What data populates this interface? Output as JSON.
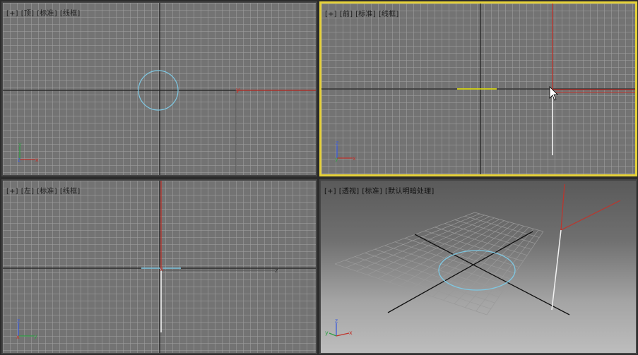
{
  "viewports": {
    "top": {
      "plus": "[+]",
      "view": "[顶]",
      "shading": "[标准]",
      "mode": "[线框]"
    },
    "front": {
      "plus": "[+]",
      "view": "[前]",
      "shading": "[标准]",
      "mode": "[线框]"
    },
    "left": {
      "plus": "[+]",
      "view": "[左]",
      "shading": "[标准]",
      "mode": "[线框]"
    },
    "persp": {
      "plus": "[+]",
      "view": "[透视]",
      "shading": "[标准]",
      "mode": "[默认明暗处理]"
    }
  },
  "axis_letters": {
    "x": "x",
    "y": "y",
    "z": "z"
  },
  "colors": {
    "active_border": "#e6d23a",
    "circle": "#7ec8e3",
    "axis_red": "#c0332b",
    "gizmo_blue": "#3b5bdb",
    "gizmo_green": "#2f9e44"
  }
}
